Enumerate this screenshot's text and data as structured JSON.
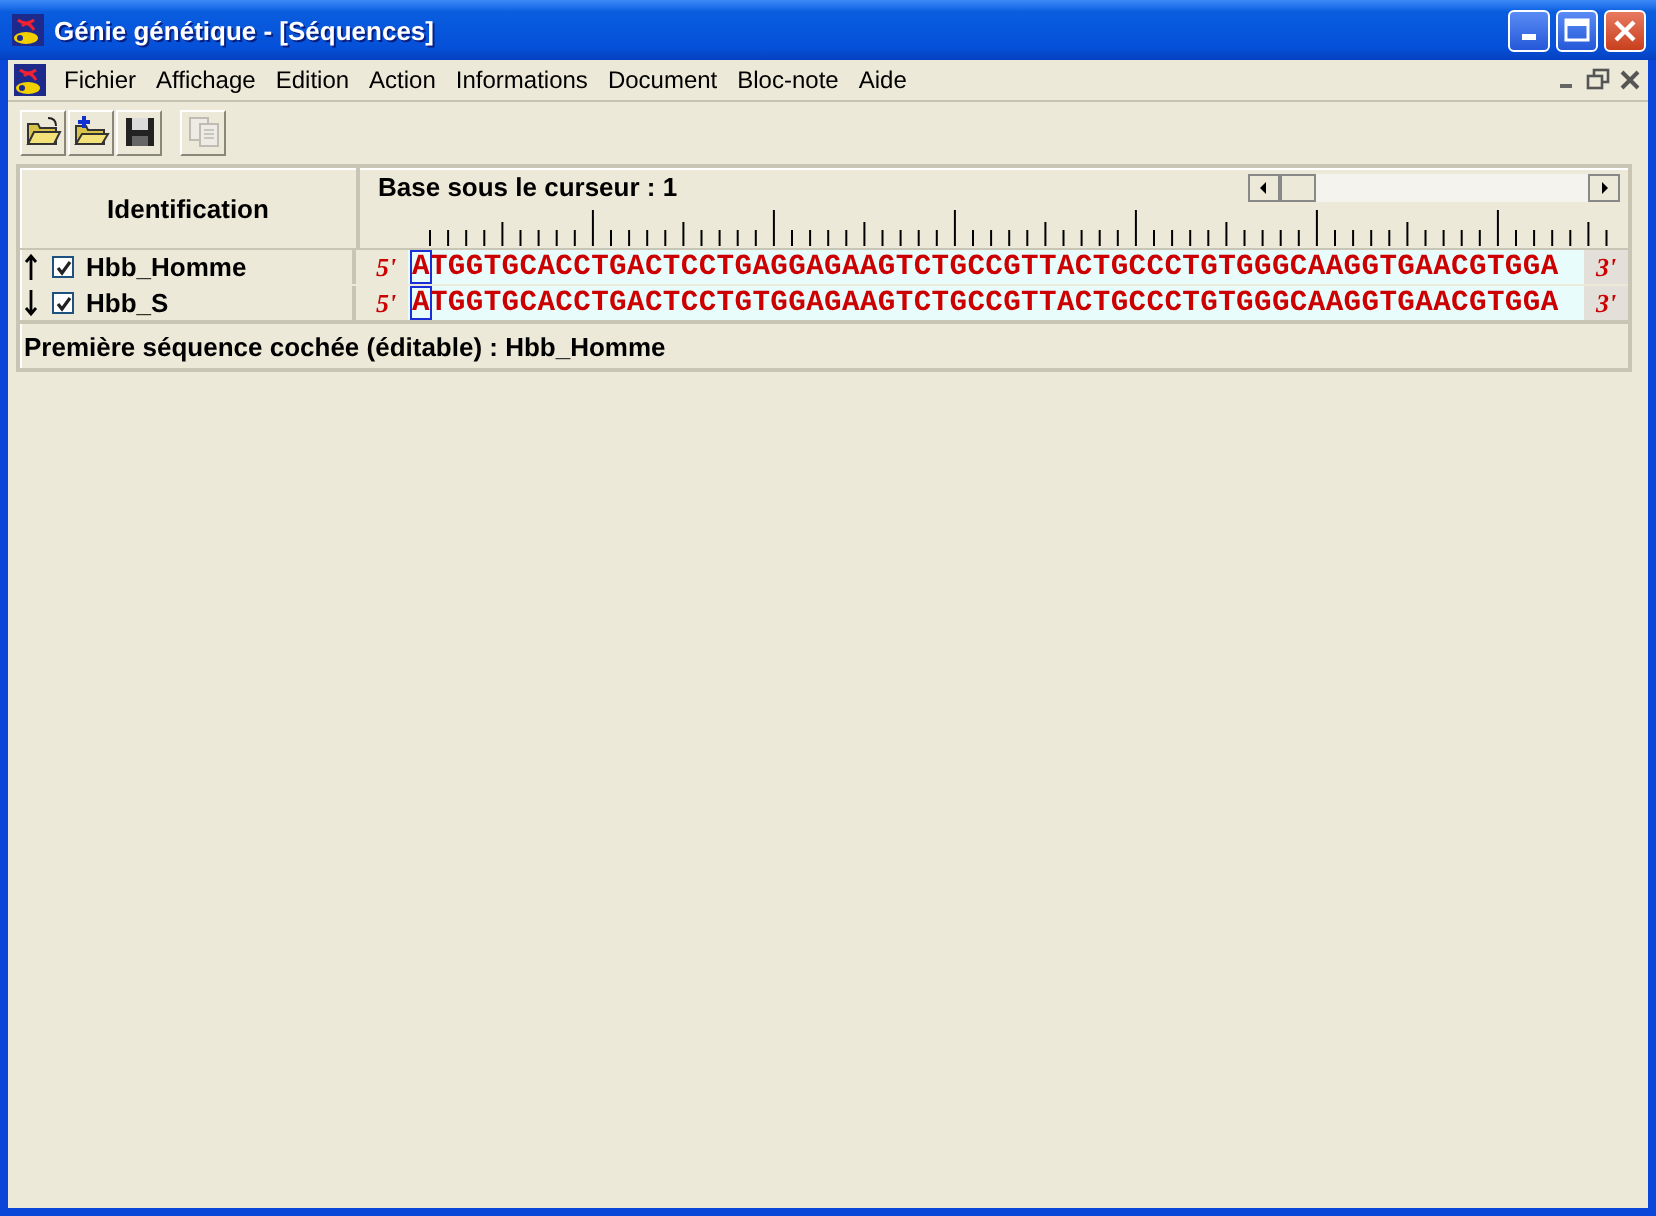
{
  "window": {
    "title": "Génie génétique - [Séquences]"
  },
  "menu": [
    "Fichier",
    "Affichage",
    "Edition",
    "Action",
    "Informations",
    "Document",
    "Bloc-note",
    "Aide"
  ],
  "toolbar": [
    {
      "disabled": false
    },
    {
      "disabled": false
    },
    {
      "disabled": false
    },
    {
      "disabled": true
    }
  ],
  "sequence_panel": {
    "header": "Identification",
    "cursor_label": "Base sous le curseur : 1",
    "sequences": [
      {
        "name": "Hbb_Homme",
        "checked": true,
        "start": "5'",
        "bases": "ATGGTGCACCTGACTCCTGAGGAGAAGTCTGCCGTTACTGCCCTGTGGGCAAGGTGAACGTGGA",
        "end": "3'"
      },
      {
        "name": "Hbb_S",
        "checked": true,
        "start": "5'",
        "bases": "ATGGTGCACCTGACTCCTGTGGAGAAGTCTGCCGTTACTGCCCTGTGGGCAAGGTGAACGTGGA",
        "end": "3'"
      }
    ],
    "status": "Première séquence cochée (éditable) : Hbb_Homme"
  }
}
